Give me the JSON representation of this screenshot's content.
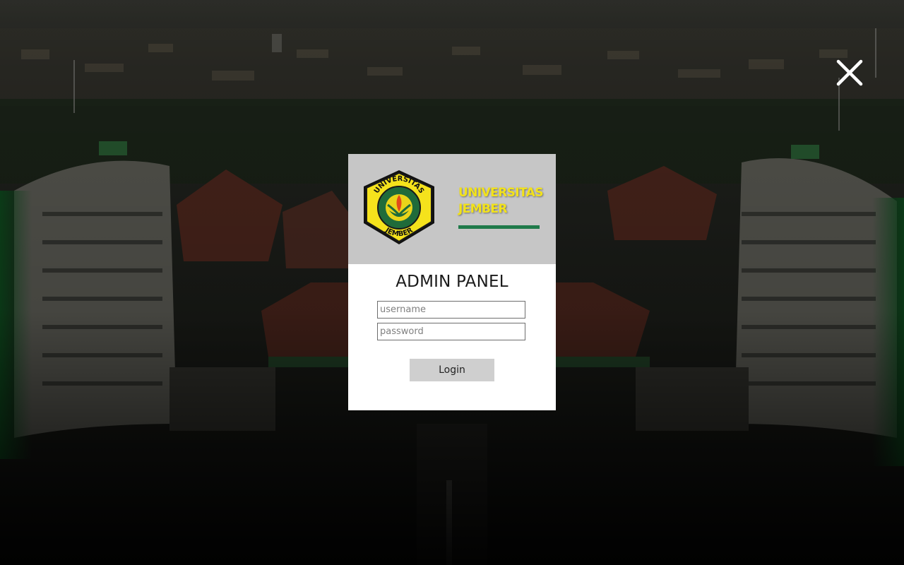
{
  "window": {
    "close_icon": "close-icon"
  },
  "header": {
    "logo_icon": "universitas-jember-seal",
    "logo_text_top": "UNIVERSITAS",
    "logo_text_bottom": "JEMBER",
    "brand_line1": "UNIVERSITAS",
    "brand_line2": "JEMBER",
    "brand_color": "#f2e21b",
    "accent_color": "#1f7a4a"
  },
  "form": {
    "title": "ADMIN PANEL",
    "username_placeholder": "username",
    "username_value": "",
    "password_placeholder": "password",
    "password_value": "",
    "login_label": "Login"
  }
}
